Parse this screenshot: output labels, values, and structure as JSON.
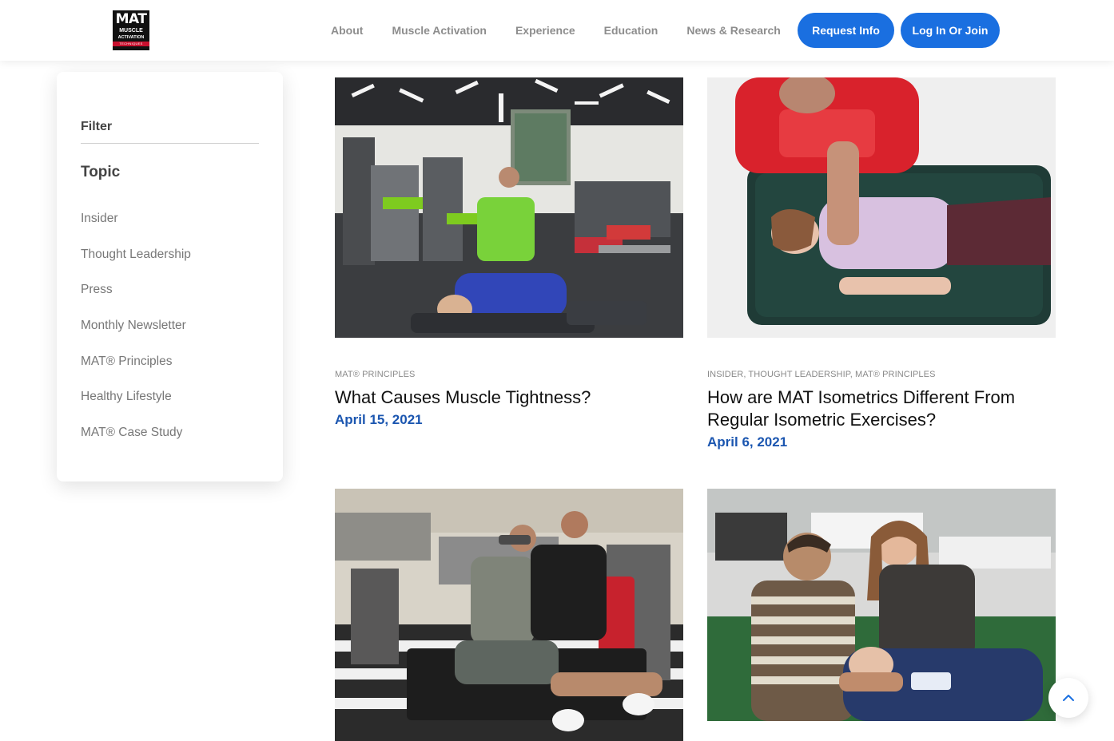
{
  "logo": {
    "main": "MAT",
    "line1": "MUSCLE",
    "line2": "ACTIVATION",
    "line3": "TECHNIQUES"
  },
  "nav": {
    "items": [
      "About",
      "Muscle Activation",
      "Experience",
      "Education",
      "News & Research"
    ],
    "request_label": "Request Info",
    "login_label": "Log In Or Join"
  },
  "sidebar": {
    "filter_label": "Filter",
    "topic_label": "Topic",
    "topics": [
      "Insider",
      "Thought Leadership",
      "Press",
      "Monthly Newsletter",
      "MAT® Principles",
      "Healthy Lifestyle",
      "MAT® Case Study"
    ]
  },
  "posts": [
    {
      "category": "MAT® PRINCIPLES",
      "title": "What Causes Muscle Tightness?",
      "date": "April 15, 2021"
    },
    {
      "category": "INSIDER, THOUGHT LEADERSHIP, MAT® PRINCIPLES",
      "title": "How are MAT Isometrics Different From Regular Isometric Exercises?",
      "date": "April 6, 2021"
    }
  ],
  "colors": {
    "brand_blue": "#1a6fe0",
    "date_blue": "#1b56b0",
    "logo_red": "#c8102e"
  },
  "icons": {
    "scroll_top": "chevron-up-icon"
  }
}
